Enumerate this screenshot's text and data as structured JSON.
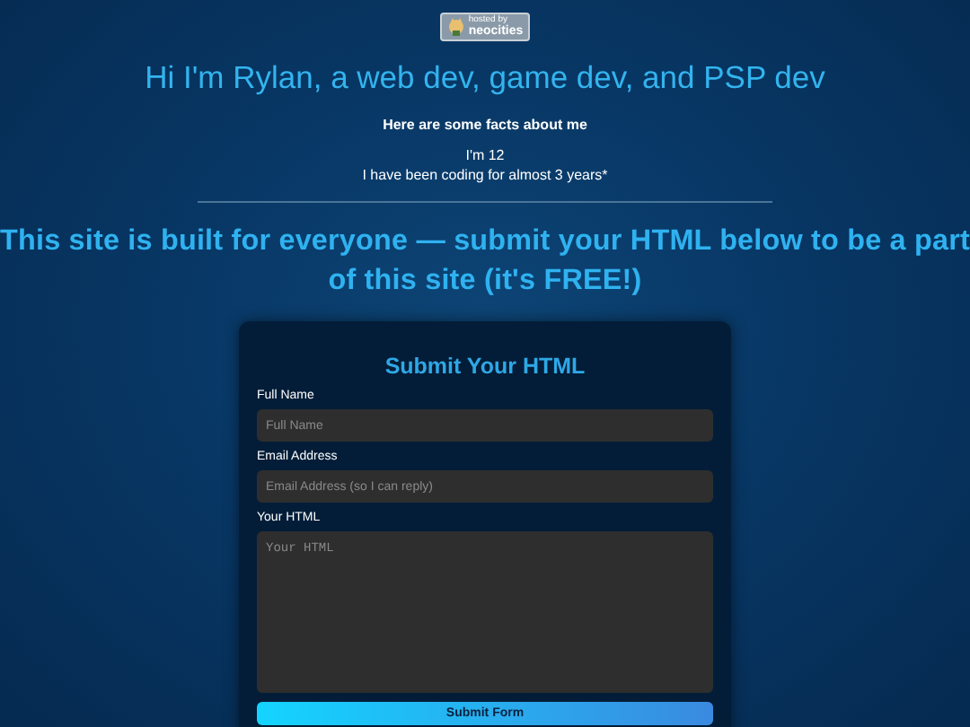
{
  "badge": {
    "line_1": "hosted by",
    "line_2": "neocities"
  },
  "heading": "Hi I'm Rylan, a web dev, game dev, and PSP dev",
  "facts": {
    "title": "Here are some facts about me",
    "items": [
      "I'm 12",
      "I have been coding for almost 3 years*"
    ]
  },
  "banner": "This site is built for everyone — submit your HTML below to be a part of this site (it's FREE!)",
  "form": {
    "title": "Submit Your HTML",
    "fields": [
      {
        "kind": "input",
        "label": "Full Name",
        "placeholder": "Full Name"
      },
      {
        "kind": "input",
        "label": "Email Address",
        "placeholder": "Email Address (so I can reply)"
      },
      {
        "kind": "textarea",
        "label": "Your HTML",
        "placeholder": "Your HTML"
      }
    ],
    "submit": "Submit Form"
  }
}
